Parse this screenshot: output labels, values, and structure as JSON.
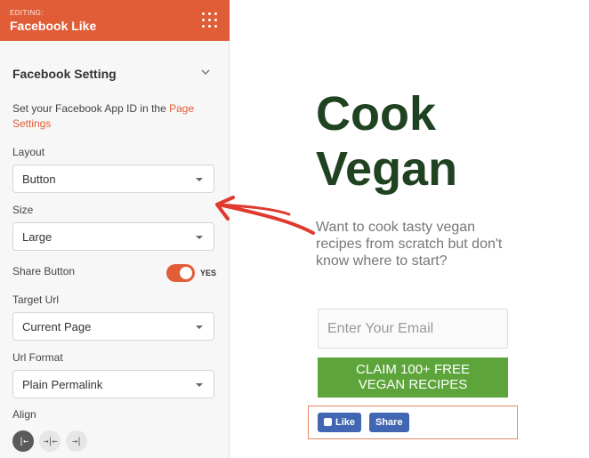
{
  "panel": {
    "editing_label": "EDITING:",
    "title": "Facebook Like",
    "section_title": "Facebook Setting",
    "description_prefix": "Set your Facebook App ID in the ",
    "description_link": "Page Settings",
    "layout": {
      "label": "Layout",
      "value": "Button"
    },
    "size": {
      "label": "Size",
      "value": "Large"
    },
    "share_button": {
      "label": "Share Button",
      "state": "YES"
    },
    "target_url": {
      "label": "Target Url",
      "value": "Current Page"
    },
    "url_format": {
      "label": "Url Format",
      "value": "Plain Permalink"
    },
    "align": {
      "label": "Align",
      "options": [
        "left",
        "center",
        "right"
      ],
      "selected": "left"
    }
  },
  "preview": {
    "headline_line1": "Cook",
    "headline_line2": "Vegan",
    "subtext": "Want to cook tasty vegan recipes from scratch but don't know where to start?",
    "email_placeholder": "Enter Your Email",
    "cta_line1": "CLAIM 100+ FREE",
    "cta_line2": "VEGAN RECIPES",
    "fb_like_label": "Like",
    "fb_share_label": "Share"
  },
  "colors": {
    "accent": "#e05d38",
    "headline": "#1f4221",
    "cta": "#5da53b",
    "facebook": "#4267b2",
    "annotation_arrow": "#e03a2f"
  }
}
